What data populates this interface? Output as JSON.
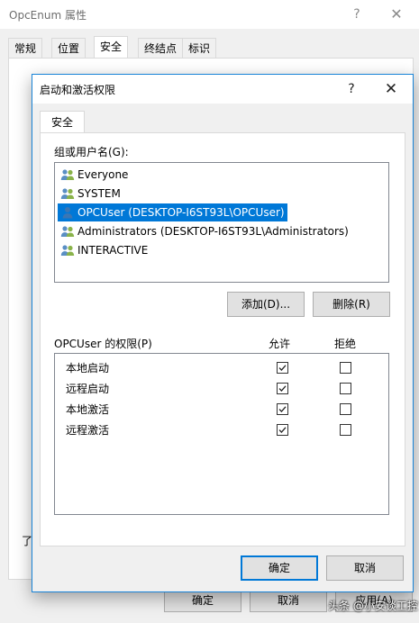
{
  "background_window": {
    "title": "OpcEnum 属性",
    "help": "?",
    "close": "✕",
    "tabs": [
      "常规",
      "位置",
      "安全",
      "终结点",
      "标识"
    ],
    "partial_text": "了",
    "buttons": {
      "ok": "确定",
      "cancel": "取消",
      "apply": "应用(A)"
    }
  },
  "dialog": {
    "title": "启动和激活权限",
    "help": "?",
    "close": "✕",
    "tab": "安全",
    "group_label": "组或用户名(G):",
    "users": [
      {
        "name": "Everyone",
        "icon": "group-users-icon",
        "selected": false
      },
      {
        "name": "SYSTEM",
        "icon": "group-users-icon",
        "selected": false
      },
      {
        "name": "OPCUser (DESKTOP-I6ST93L\\OPCUser)",
        "icon": "single-user-icon",
        "selected": true
      },
      {
        "name": "Administrators (DESKTOP-I6ST93L\\Administrators)",
        "icon": "group-users-icon",
        "selected": false
      },
      {
        "name": "INTERACTIVE",
        "icon": "group-users-icon",
        "selected": false
      }
    ],
    "add_button": "添加(D)...",
    "remove_button": "删除(R)",
    "permissions_label": "OPCUser 的权限(P)",
    "allow_header": "允许",
    "deny_header": "拒绝",
    "permissions": [
      {
        "name": "本地启动",
        "allow": true,
        "deny": false
      },
      {
        "name": "远程启动",
        "allow": true,
        "deny": false
      },
      {
        "name": "本地激活",
        "allow": true,
        "deny": false
      },
      {
        "name": "远程激活",
        "allow": true,
        "deny": false
      }
    ],
    "ok_button": "确定",
    "cancel_button": "取消"
  },
  "watermark": "头条 @小安谈工控",
  "colors": {
    "selection": "#0078d7",
    "dialog_border": "#1883d7"
  }
}
